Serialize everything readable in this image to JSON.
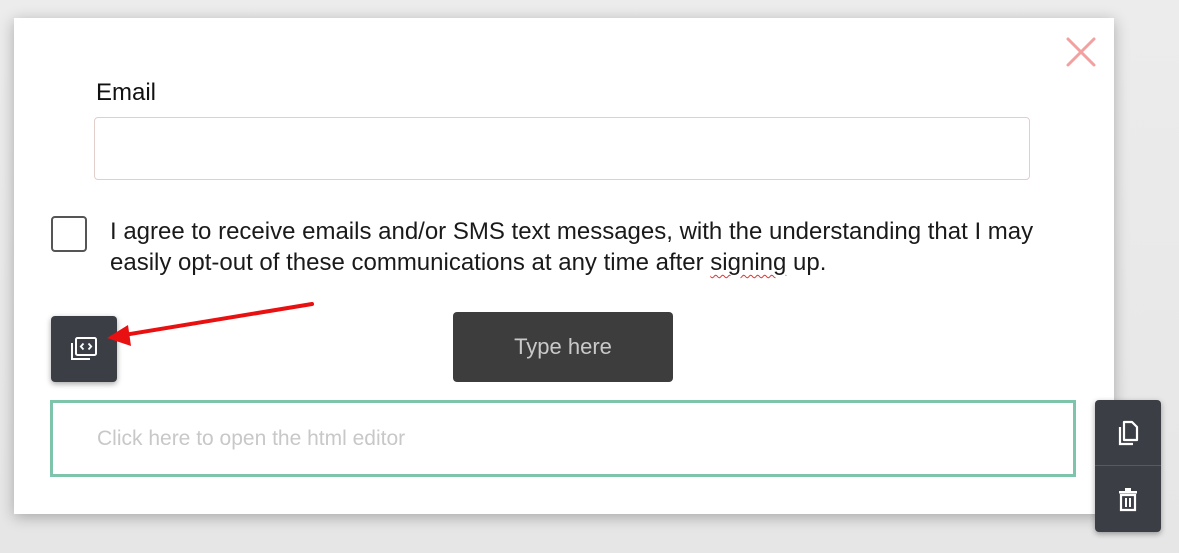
{
  "form": {
    "email_label": "Email",
    "email_value": "",
    "consent_text_before": "I agree to receive emails and/or SMS text messages, with the understanding that I may easily opt-out of these communications at any time after ",
    "consent_text_misspelled": "signing",
    "consent_text_after": " up.",
    "consent_checked": false,
    "submit_label": "Type here"
  },
  "editor": {
    "placeholder": "Click here to open the html editor"
  },
  "icons": {
    "close": "close-icon",
    "embed": "code-embed-icon",
    "copy": "copy-icon",
    "delete": "trash-icon",
    "annotation": "red-arrow"
  },
  "colors": {
    "close_icon": "#f2a0a0",
    "editor_border": "#7ec4aa",
    "toolbar_bg": "#3b3e45",
    "button_bg": "#3d3d3d",
    "annotation_arrow": "#e81010"
  }
}
